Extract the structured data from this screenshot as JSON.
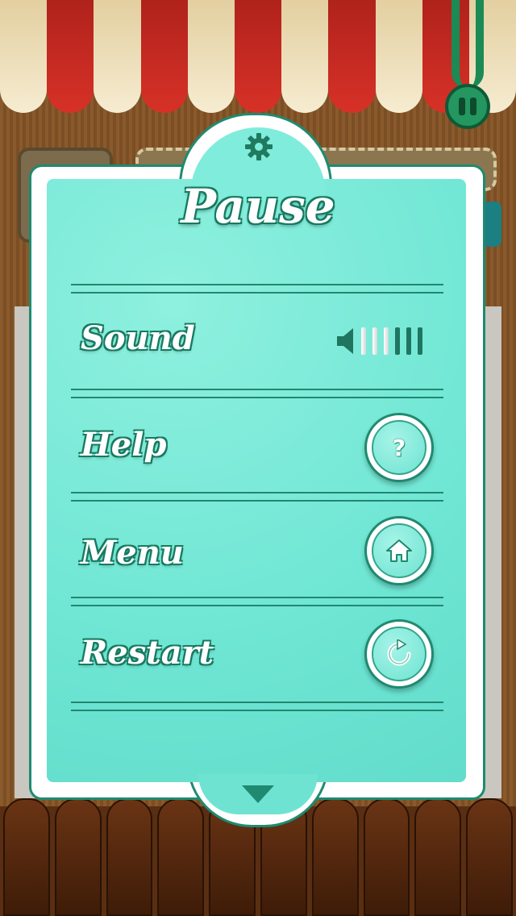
{
  "dialog": {
    "title": "Pause"
  },
  "rows": {
    "sound": {
      "label": "Sound",
      "volume_level": "3/6"
    },
    "help": {
      "label": "Help",
      "icon": "question-icon",
      "icon_glyph": "?"
    },
    "menu": {
      "label": "Menu",
      "icon": "home-icon"
    },
    "restart": {
      "label": "Restart",
      "icon": "restart-icon"
    }
  },
  "colors": {
    "panel_teal": "#6fe6d4",
    "accent_green": "#1f8a70",
    "awning_red": "#c82a22",
    "awning_cream": "#f2e6c8"
  }
}
